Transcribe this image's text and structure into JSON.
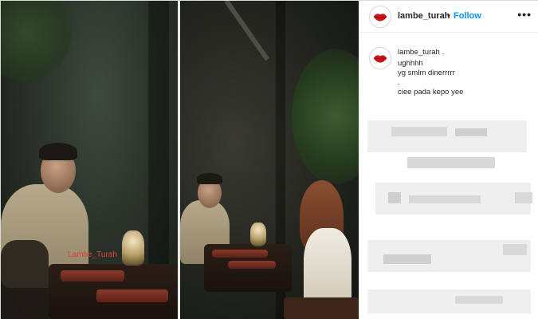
{
  "post": {
    "username": "lambe_turah",
    "separator": "•",
    "follow_label": "Follow",
    "more_label": "•••"
  },
  "caption": {
    "username": "lambe_turah .",
    "lines": [
      "ughhhh",
      "yg smlm dinerrrrr",
      ".",
      "ciee pada kepo yee"
    ]
  },
  "photo": {
    "watermark_left": "Lambe_Turah"
  },
  "colors": {
    "follow_blue": "#0095f6",
    "logo_red": "#d0161c"
  },
  "icons": {
    "avatar": "lips-logo-icon",
    "more": "more-options-icon"
  }
}
